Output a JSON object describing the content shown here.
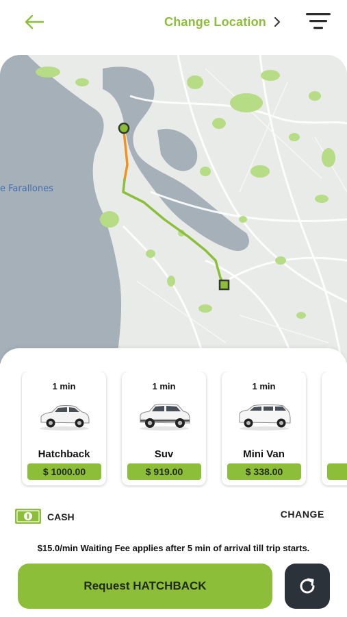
{
  "header": {
    "back_icon": "arrow-left-icon",
    "change_location_label": "Change Location",
    "chevron_icon": "chevron-right-icon",
    "filter_icon": "filter-icon"
  },
  "map": {
    "place_label": "e Farallones",
    "route_colors": {
      "traffic": "#f0921e",
      "normal": "#8dbe3a"
    }
  },
  "vehicles": [
    {
      "eta": "1 min",
      "name": "Hatchback",
      "price": "$ 1000.00",
      "icon": "hatchback-car-icon"
    },
    {
      "eta": "1 min",
      "name": "Suv",
      "price": "$ 919.00",
      "icon": "suv-car-icon"
    },
    {
      "eta": "1 min",
      "name": "Mini Van",
      "price": "$ 338.00",
      "icon": "minivan-car-icon"
    }
  ],
  "payment": {
    "icon": "cash-icon",
    "method": "CASH",
    "change_label": "CHANGE"
  },
  "fee_note": "$15.0/min Waiting Fee applies after 5 min of arrival till trip starts.",
  "request_button": "Request HATCHBACK",
  "refresh_icon": "refresh-icon",
  "colors": {
    "accent": "#8dbe3a",
    "dark_button": "#2c323a"
  }
}
